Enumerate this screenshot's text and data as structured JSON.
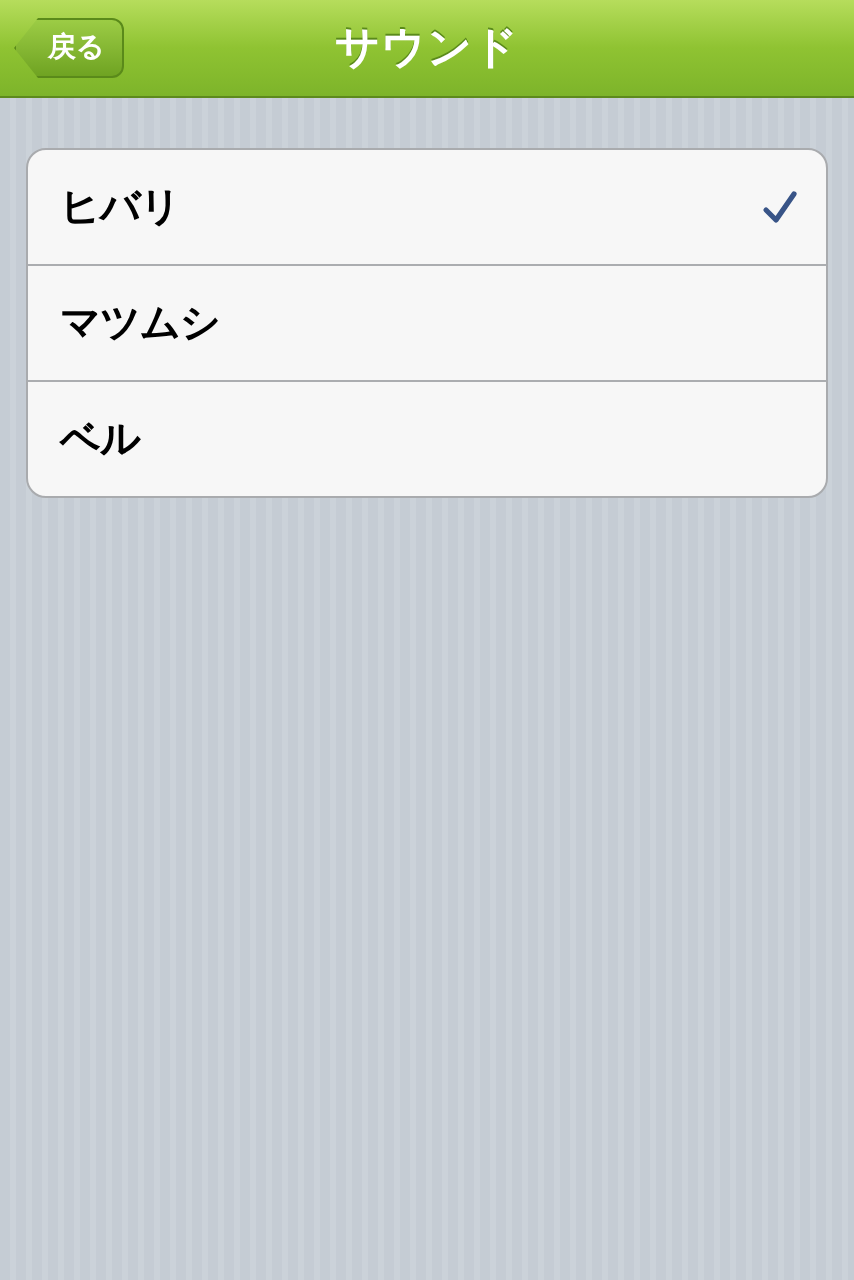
{
  "nav_bar": {
    "back_button": "戻る",
    "title": "サウンド"
  },
  "sounds": [
    {
      "label": "ヒバリ",
      "selected": true
    },
    {
      "label": "マツムシ",
      "selected": false
    },
    {
      "label": "ベル",
      "selected": false
    }
  ]
}
